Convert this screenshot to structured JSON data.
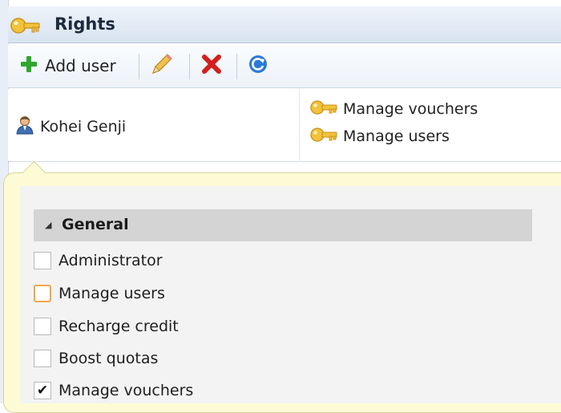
{
  "header": {
    "title": "Rights",
    "icon": "key-icon"
  },
  "toolbar": {
    "add_label": "Add user",
    "icons": [
      "plus-icon",
      "pencil-icon",
      "delete-icon",
      "refresh-icon"
    ]
  },
  "user_row": {
    "name": "Kohei Genji",
    "rights": [
      "Manage vouchers",
      "Manage users"
    ]
  },
  "rights_panel": {
    "group_title": "General",
    "options": [
      {
        "label": "Administrator",
        "checked": false
      },
      {
        "label": "Manage users",
        "checked": false
      },
      {
        "label": "Recharge credit",
        "checked": false
      },
      {
        "label": "Boost quotas",
        "checked": false
      },
      {
        "label": "Manage vouchers",
        "checked": true
      }
    ]
  },
  "colors": {
    "header_bg": "#d8e3f0",
    "popup_bg": "#fdfbd5",
    "group_header_bg": "#d4d4d4",
    "focus_border": "#f0a64a",
    "add_green": "#2fa62f",
    "delete_red": "#d41f1f",
    "refresh_blue": "#2a7ad8"
  },
  "check_glyph": "✔"
}
